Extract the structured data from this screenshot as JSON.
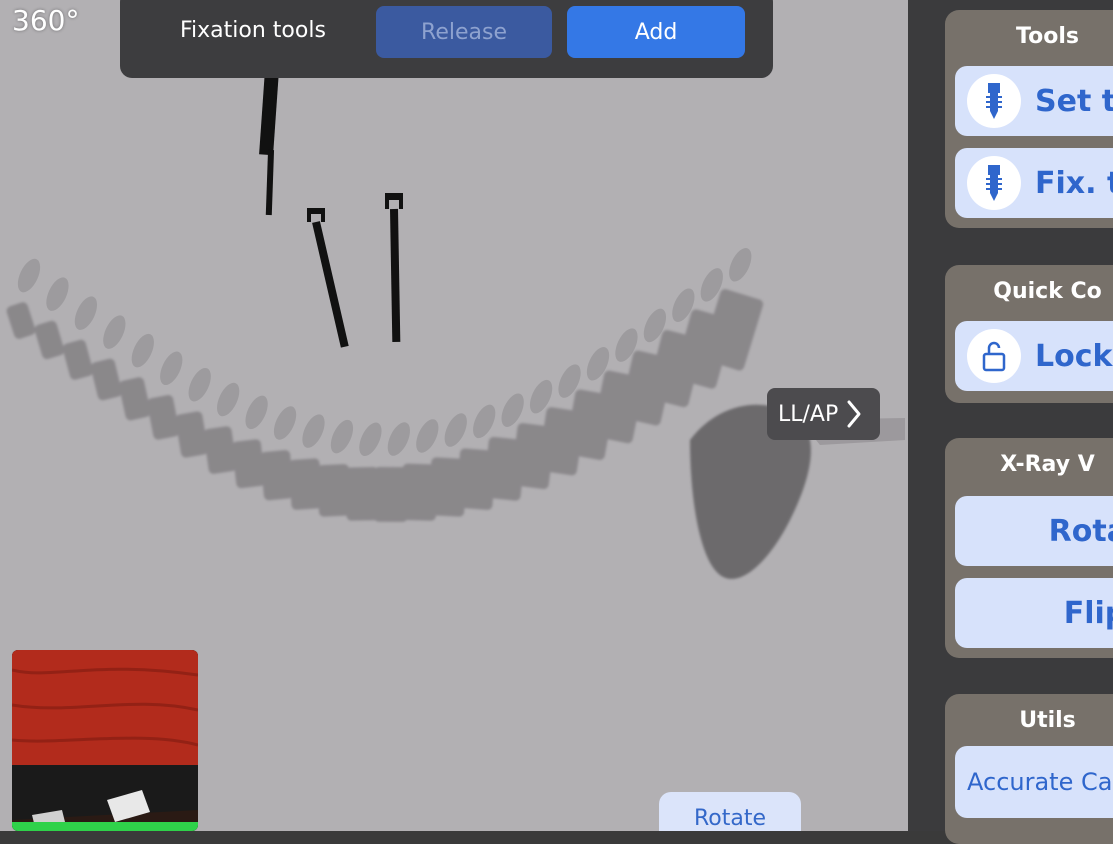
{
  "view": {
    "mode_label": "360°",
    "view_toggle_label": "LL/AP",
    "rotate_label": "Rotate"
  },
  "fixation_panel": {
    "label": "Fixation tools",
    "release_label": "Release",
    "add_label": "Add"
  },
  "sidebar": {
    "tools": {
      "title": "Tools",
      "buttons": [
        {
          "label": "Set to",
          "icon": "screw-icon"
        },
        {
          "label": "Fix. to",
          "icon": "screw-icon"
        }
      ]
    },
    "quick_controls": {
      "title": "Quick Co",
      "buttons": [
        {
          "label": "Lock P",
          "icon": "unlock-icon"
        }
      ]
    },
    "xray_view": {
      "title": "X-Ray V",
      "buttons": [
        {
          "label": "Rotat"
        },
        {
          "label": "Flip"
        }
      ]
    },
    "utils": {
      "title": "Utils",
      "buttons": [
        {
          "label": "Accurate Cal"
        }
      ]
    }
  },
  "colors": {
    "viewport_bg": "#b2b0b3",
    "panel_bg": "#3b3b3d",
    "accent_blue": "#3478e6",
    "button_light": "#d7e2fb",
    "section_bg": "#77716a"
  }
}
